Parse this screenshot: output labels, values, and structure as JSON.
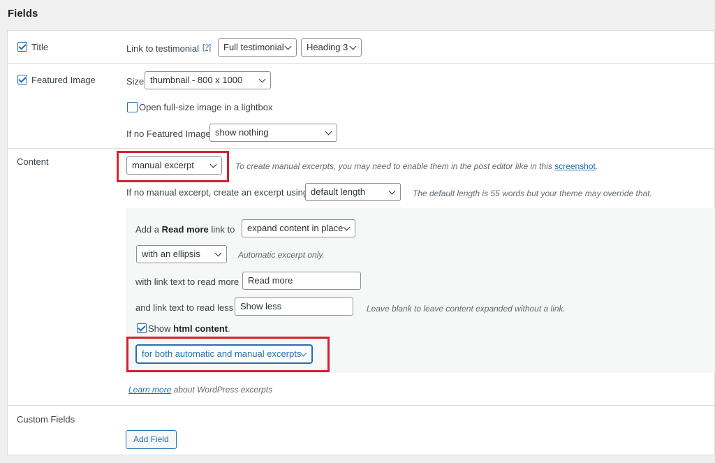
{
  "heading": "Fields",
  "title_row": {
    "label": "Title",
    "checked": true,
    "link_label": "Link to testimonial",
    "help": "[?]",
    "link_select": "Full testimonial",
    "heading_select": "Heading 3"
  },
  "image_row": {
    "label": "Featured Image",
    "checked": true,
    "size_label": "Size",
    "size_select": "thumbnail - 800 x 1000",
    "lightbox_label": "Open full-size image in a lightbox",
    "lightbox_checked": false,
    "no_image_label": "If no Featured Image",
    "no_image_select": "show nothing"
  },
  "content_row": {
    "label": "Content",
    "content_select": "manual excerpt",
    "manual_hint_prefix": "To create manual excerpts, you may need to enable them in the post editor like in this ",
    "manual_hint_link": "screenshot",
    "manual_hint_suffix": ".",
    "no_excerpt_label": "If no manual excerpt, create an excerpt using",
    "length_select": "default length",
    "length_hint": "The default length is 55 words but your theme may override that.",
    "read_more_pre": "Add a ",
    "read_more_bold": "Read more",
    "read_more_post": " link to",
    "read_more_select": "expand content in place",
    "ellipsis_select": "with an ellipsis",
    "ellipsis_hint": "Automatic excerpt only.",
    "more_text_label": "with link text to read more",
    "more_text_value": "Read more",
    "less_text_label": "and link text to read less",
    "less_text_value": "Show less",
    "less_hint": "Leave blank to leave content expanded without a link.",
    "html_pre": "Show ",
    "html_bold": "html content",
    "html_post": ".",
    "html_checked": true,
    "html_select": "for both automatic and manual excerpts",
    "learn_more_link": "Learn more",
    "learn_more_rest": " about WordPress excerpts"
  },
  "custom_row": {
    "label": "Custom Fields",
    "add_button": "Add Field"
  },
  "colors": {
    "accent": "#2271b1",
    "highlight": "#d1222f"
  }
}
